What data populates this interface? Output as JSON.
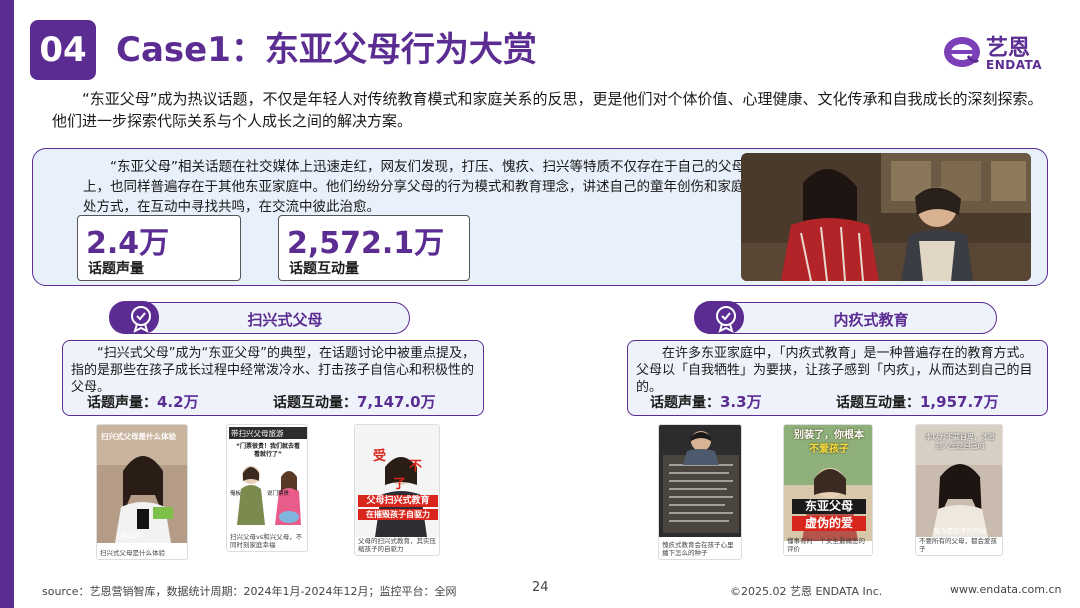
{
  "header": {
    "section_number": "04",
    "title": "Case1：东亚父母行为大赏",
    "logo_cn": "艺恩",
    "logo_en": "ENDATA"
  },
  "intro": "“东亚父母”成为热议话题，不仅是年轻人对传统教育模式和家庭关系的反思，更是他们对个体价值、心理健康、文化传承和自我成长的深刻探索。他们进一步探索代际关系与个人成长之间的解决方案。",
  "overview": {
    "text": "“东亚父母”相关话题在社交媒体上迅速走红，网友们发现，打压、愧疚、扫兴等特质不仅存在于自己的父母身上，也同样普遍存在于其他东亚家庭中。他们纷纷分享父母的行为模式和教育理念，讲述自己的童年创伤和家庭相处方式，在互动中寻找共鸣，在交流中彼此治愈。",
    "stats": [
      {
        "value": "2.4万",
        "label": "话题声量"
      },
      {
        "value": "2,572.1万",
        "label": "话题互动量"
      }
    ]
  },
  "left": {
    "tag": "扫兴式父母",
    "desc": "“扫兴式父母”成为“东亚父母”的典型，在话题讨论中被重点提及，指的是那些在孩子成长过程中经常泼冷水、打击孩子自信心和积极性的父母。",
    "volume_label": "话题声量：",
    "volume_value": "4.2万",
    "interact_label": "话题互动量：",
    "interact_value": "7,147.0万",
    "thumbs": [
      {
        "overlay": "扫兴式父母是什么体验",
        "bottom": "胸前的",
        "caption": "扫兴式父母是什么体验"
      },
      {
        "overlay": "带扫兴父母旅游",
        "bubble": "“门票很贵！我们就去看看就行了”",
        "tag1": "俺板",
        "tag2": "说门票贵",
        "caption": "扫兴父母vs和兴父母，不同时刻家庭幸福"
      },
      {
        "overlay1": "受",
        "overlay2": "不",
        "overlay3": "了",
        "banner1": "父母扫兴式教育",
        "banner2": "在摧毁孩子自驱力",
        "caption": "父母的扫兴式教育，其实压缩孩子的自驱力"
      }
    ]
  },
  "right": {
    "tag": "内疚式教育",
    "desc": "在许多东亚家庭中，「内疚式教育」是一种普遍存在的教育方式。父母以「自我牺牲」为要挟，让孩子感到「内疚」，从而达到自己的目的。",
    "volume_label": "话题声量：",
    "volume_value": "3.3万",
    "interact_label": "话题互动量：",
    "interact_value": "1,957.7万",
    "thumbs": [
      {
        "caption": "愧疚式教育会在孩子心里播下怎么的种子"
      },
      {
        "overlay1": "别装了，你根本",
        "overlay2": "不爱孩子",
        "banner1": "东亚父母",
        "banner2": "虚伪的爱",
        "caption": "懂事有时一个女生最痛恶的评价"
      },
      {
        "overlay": "本以为不要自卑，才愿意人生是自己的",
        "bottom": "我为是孩子的开始",
        "caption": "不要所有的父母，都会爱孩子"
      }
    ]
  },
  "footer": {
    "source": "source：艺恩营销智库，数据统计周期：2024年1月-2024年12月；监控平台：全网",
    "page": "24",
    "copyright": "©2025.02 艺恩 ENDATA Inc.",
    "website": "www.endata.com.cn"
  },
  "colors": {
    "brand": "#5b2c91",
    "card_bg": "#e8f0fb",
    "accent_red": "#d9261c"
  }
}
